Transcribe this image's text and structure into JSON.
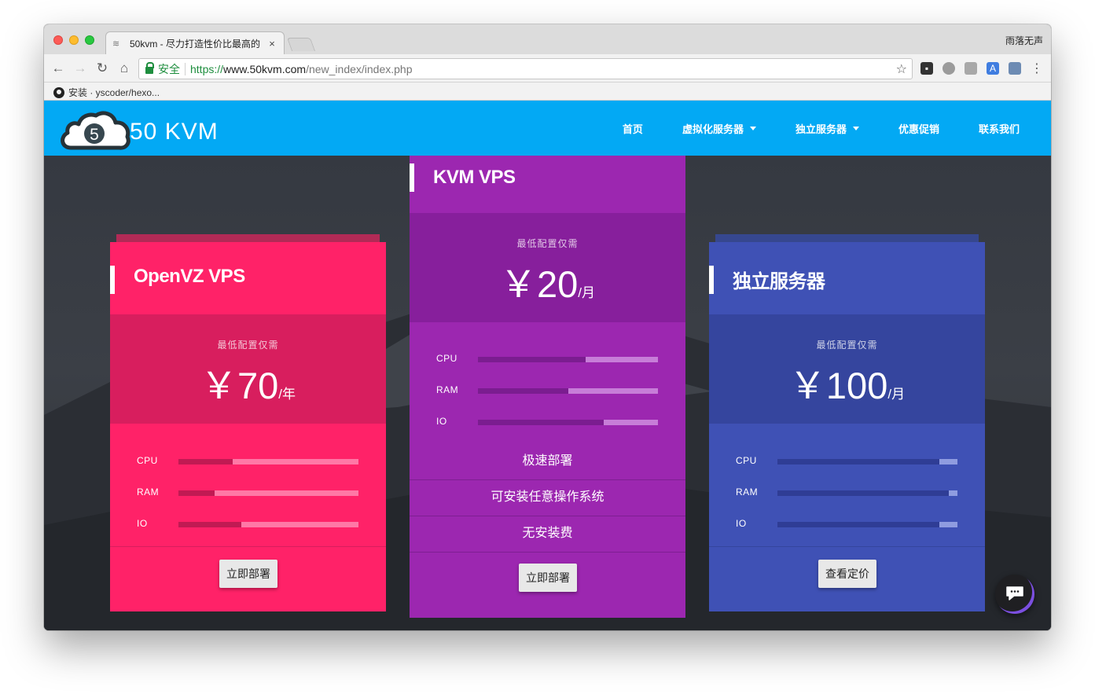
{
  "browser": {
    "tab_title": "50kvm - 尽力打造性价比最高的",
    "tab_close": "×",
    "profile_name": "雨落无声",
    "secure_label": "安全",
    "url_scheme": "https://",
    "url_host": "www.50kvm.com",
    "url_path": "/new_index/index.php",
    "bookmark": "安装 · yscoder/hexo..."
  },
  "site": {
    "logo_digit": "5",
    "logo_text": "50 KVM",
    "brand_color": "#03a9f4",
    "nav": {
      "home": "首页",
      "virtual": "虚拟化服务器",
      "dedicated": "独立服务器",
      "promo": "优惠促销",
      "contact": "联系我们"
    }
  },
  "plans": [
    {
      "title": "OpenVZ VPS",
      "color": "#ff2268",
      "price_note": "最低配置仅需",
      "currency": "￥",
      "price": "70",
      "unit": "/年",
      "specs": [
        {
          "label": "CPU",
          "level": 0.3
        },
        {
          "label": "RAM",
          "level": 0.2
        },
        {
          "label": "IO",
          "level": 0.35
        }
      ],
      "button": "立即部署"
    },
    {
      "title": "KVM VPS",
      "color": "#9c27b0",
      "price_note": "最低配置仅需",
      "currency": "￥",
      "price": "20",
      "unit": "/月",
      "specs": [
        {
          "label": "CPU",
          "level": 0.6
        },
        {
          "label": "RAM",
          "level": 0.5
        },
        {
          "label": "IO",
          "level": 0.7
        }
      ],
      "features": [
        "极速部署",
        "可安装任意操作系统",
        "无安装费"
      ],
      "button": "立即部署"
    },
    {
      "title": "独立服务器",
      "color": "#3f51b5",
      "price_note": "最低配置仅需",
      "currency": "￥",
      "price": "100",
      "unit": "/月",
      "specs": [
        {
          "label": "CPU",
          "level": 0.9
        },
        {
          "label": "RAM",
          "level": 0.95
        },
        {
          "label": "IO",
          "level": 0.9
        }
      ],
      "button": "查看定价"
    }
  ]
}
